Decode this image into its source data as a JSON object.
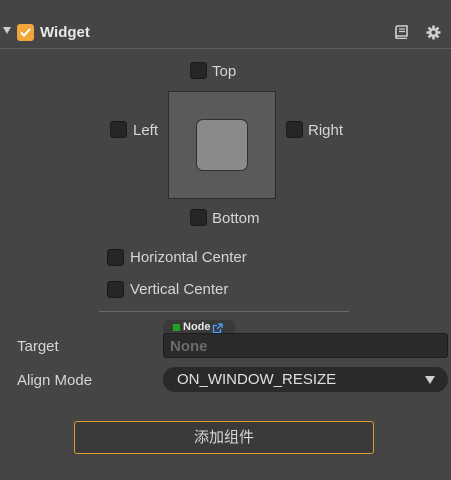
{
  "component": {
    "title": "Widget",
    "enabled": true,
    "fold_icon": "chevron-down-icon",
    "help_icon": "book-icon",
    "settings_icon": "gear-icon"
  },
  "align": {
    "top": "Top",
    "left": "Left",
    "right": "Right",
    "bottom": "Bottom",
    "horizontal_center": "Horizontal Center",
    "vertical_center": "Vertical Center"
  },
  "properties": {
    "target_label": "Target",
    "target_type": "Node",
    "target_value": "None",
    "align_mode_label": "Align Mode",
    "align_mode_value": "ON_WINDOW_RESIZE"
  },
  "add_component_button": "添加组件",
  "colors": {
    "background": "#454545",
    "accent": "#f2a53a",
    "node_tag": "#1fa31f"
  }
}
